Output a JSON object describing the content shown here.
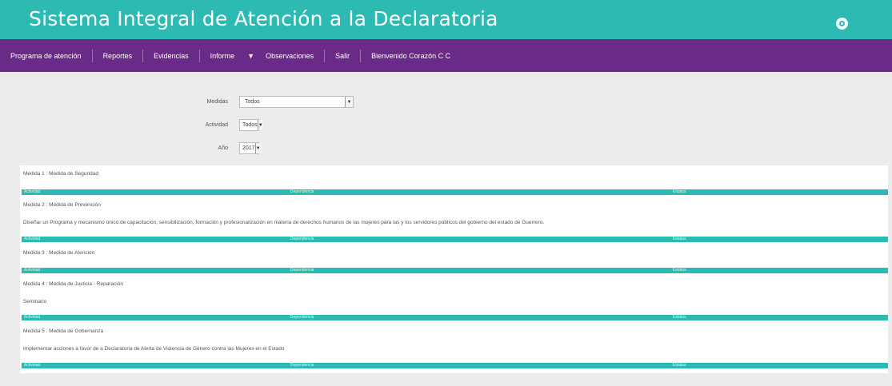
{
  "header": {
    "title": "Sistema Integral de Atención a la Declaratoria"
  },
  "nav": {
    "items": [
      "Programa de atención",
      "Reportes",
      "Evidencias",
      "Informe",
      "Observaciones",
      "Salir",
      "Bienvenido Corazón C C"
    ],
    "informe_arrow": "▼"
  },
  "filters": {
    "medidas": {
      "label": "Medidas",
      "value": "Todos"
    },
    "actividad": {
      "label": "Actividad",
      "value": "Todos"
    },
    "anio": {
      "label": "Año",
      "value": "2017"
    }
  },
  "table_headers": {
    "col1": "Actividad",
    "col2": "Dependencia",
    "col3": "Estatus"
  },
  "medidas": [
    {
      "title": "Medida 1 : Medida de Seguridad",
      "text": ""
    },
    {
      "title": "Medida 2 : Medida de Prevención",
      "text": "Diseñar un Programa y mecanismo único de capacitación, sensibilización, formación y profesionalización en materia de derechos humanos de las mujeres para las y los servidores públicos del gobierno del estado de Guerrero."
    },
    {
      "title": "Medida 3 : Medida de Atención",
      "text": ""
    },
    {
      "title": "Medida 4 : Medida de Justicia - Reparación",
      "text": "Seminario"
    },
    {
      "title": "Medida 5 : Medida de Gobernanza",
      "text": "Implementar acciones a favor de a Declaratoria de Alerta de Violencia de Género contra las Mujeres en el Estado"
    }
  ]
}
